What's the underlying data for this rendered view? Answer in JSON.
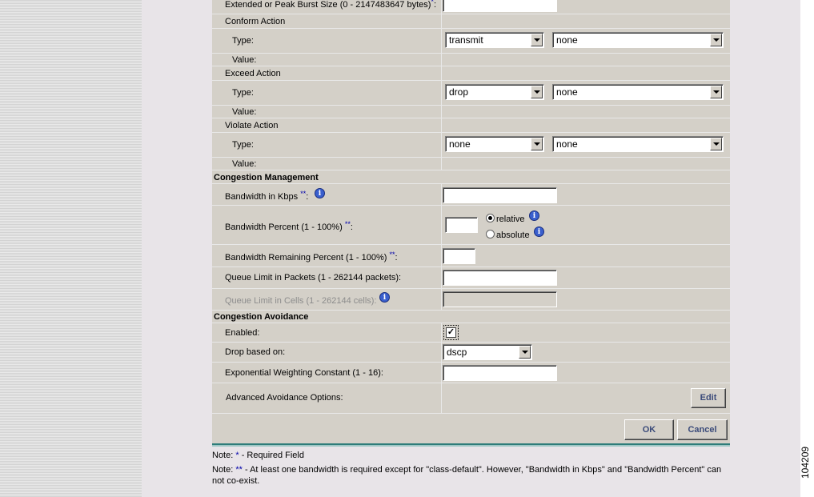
{
  "rows": {
    "burst": "Extended or Peak Burst Size (0  - 2147483647 bytes)",
    "conform_action": "Conform Action",
    "exceed_action": "Exceed Action",
    "violate_action": "Violate Action",
    "type": "Type:",
    "value": "Value:",
    "congestion_management": "Congestion Management",
    "bandwidth_kbps": "Bandwidth in Kbps",
    "bandwidth_percent": "Bandwidth Percent (1  - 100%)",
    "bandwidth_remaining": "Bandwidth Remaining Percent (1  - 100%)",
    "queue_packets": "Queue Limit in Packets (1  - 262144 packets):",
    "queue_cells": "Queue Limit in Cells (1  - 262144 cells):",
    "congestion_avoidance": "Congestion Avoidance",
    "enabled": "Enabled:",
    "drop_based_on": "Drop based on:",
    "exp_weight": "Exponential Weighting Constant (1  - 16):",
    "advanced": "Advanced Avoidance Options:"
  },
  "markers": {
    "single": "*",
    "double": "**",
    "colon": ":",
    "info": "i"
  },
  "selects": {
    "conform_type": "transmit",
    "conform_value": "none",
    "exceed_type": "drop",
    "exceed_value": "none",
    "violate_type": "none",
    "violate_value": "none",
    "drop_based": "dscp"
  },
  "radios": {
    "relative": "relative",
    "absolute": "absolute",
    "relative_checked": true
  },
  "checkbox": {
    "enabled": true,
    "mark": "✓"
  },
  "buttons": {
    "edit": "Edit",
    "ok": "OK",
    "cancel": "Cancel"
  },
  "notes": {
    "prefix": "Note: ",
    "required_text": " - Required Field",
    "bandwidth_text": " - At least one bandwidth is required except for \"class-default\". However, \"Bandwidth in Kbps\" and \"Bandwidth Percent\" can not co-exist."
  },
  "figure_number": "104209",
  "colors": {
    "panel": "#d4d0c8",
    "content_bg": "#e8e4e8",
    "accent_teal": "#2e7d7a",
    "required_marker": "#0000aa"
  }
}
